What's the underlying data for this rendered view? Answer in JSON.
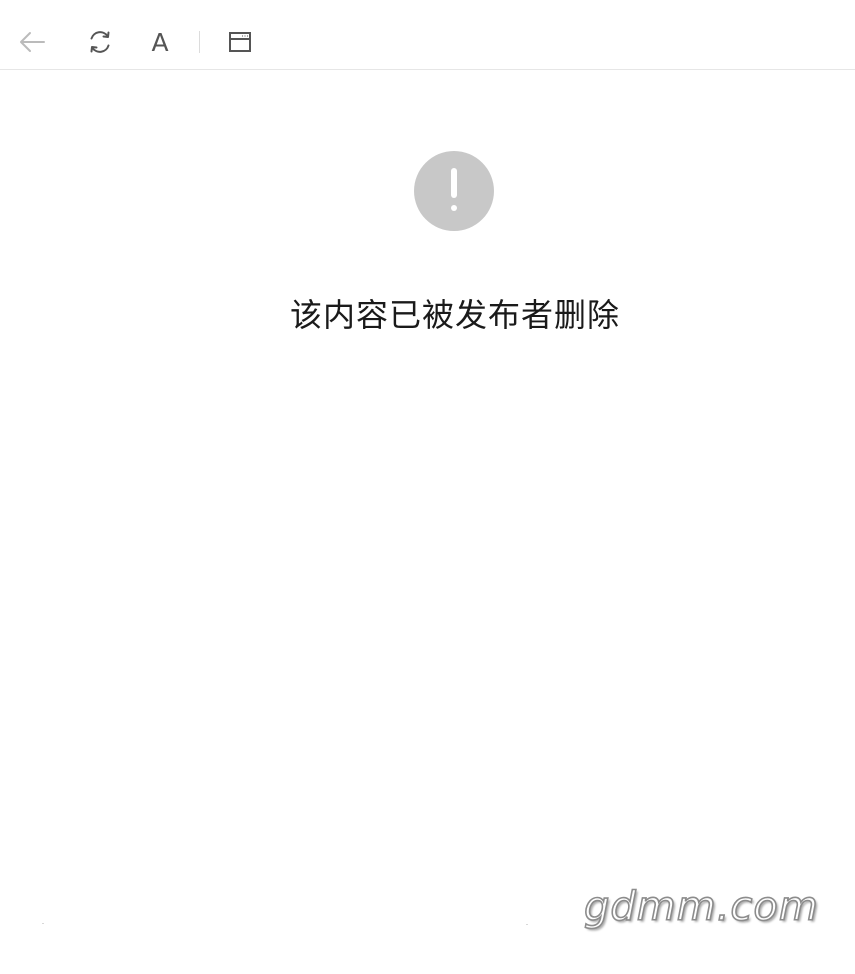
{
  "toolbar": {
    "back_icon": "arrow-left-icon",
    "refresh_icon": "refresh-icon",
    "font_label": "A",
    "window_icon": "browser-window-icon"
  },
  "colors": {
    "alert_circle": "#c8c8c8",
    "message_text": "#1a1a1a",
    "toolbar_icon": "#555555",
    "disabled_icon": "#bbbbbb"
  },
  "content": {
    "alert_icon": "exclamation-circle-icon",
    "message": "该内容已被发布者删除"
  },
  "watermark": {
    "text": "gdmm.com"
  }
}
